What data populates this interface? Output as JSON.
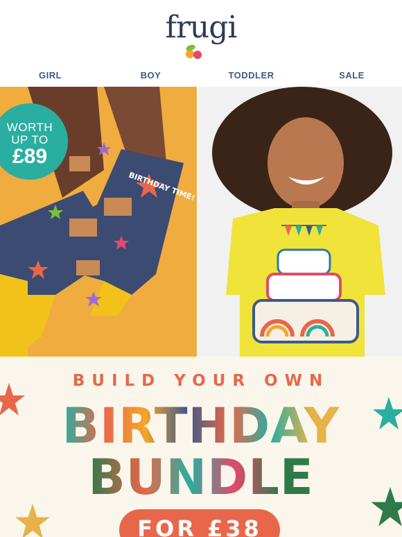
{
  "header": {
    "logo_text": "frugi"
  },
  "nav": {
    "items": [
      "GIRL",
      "BOY",
      "TODDLER",
      "SALE"
    ]
  },
  "hero": {
    "badge": {
      "line1": "WORTH",
      "line2": "UP TO",
      "price": "£89"
    },
    "sock_text": "BIRTHDAY TIME!"
  },
  "promo": {
    "kicker": "BUILD YOUR OWN",
    "headline1": "BIRTHDAY",
    "headline2": "BUNDLE",
    "price_label": "FOR £38"
  },
  "colors": {
    "brand": "#2f3a58",
    "nav_text": "#3b5a8a",
    "badge": "#2aaea0",
    "orange": "#e8674a",
    "background_yellow": "#f0ac3f",
    "promo_bg": "#fbf6ec"
  }
}
